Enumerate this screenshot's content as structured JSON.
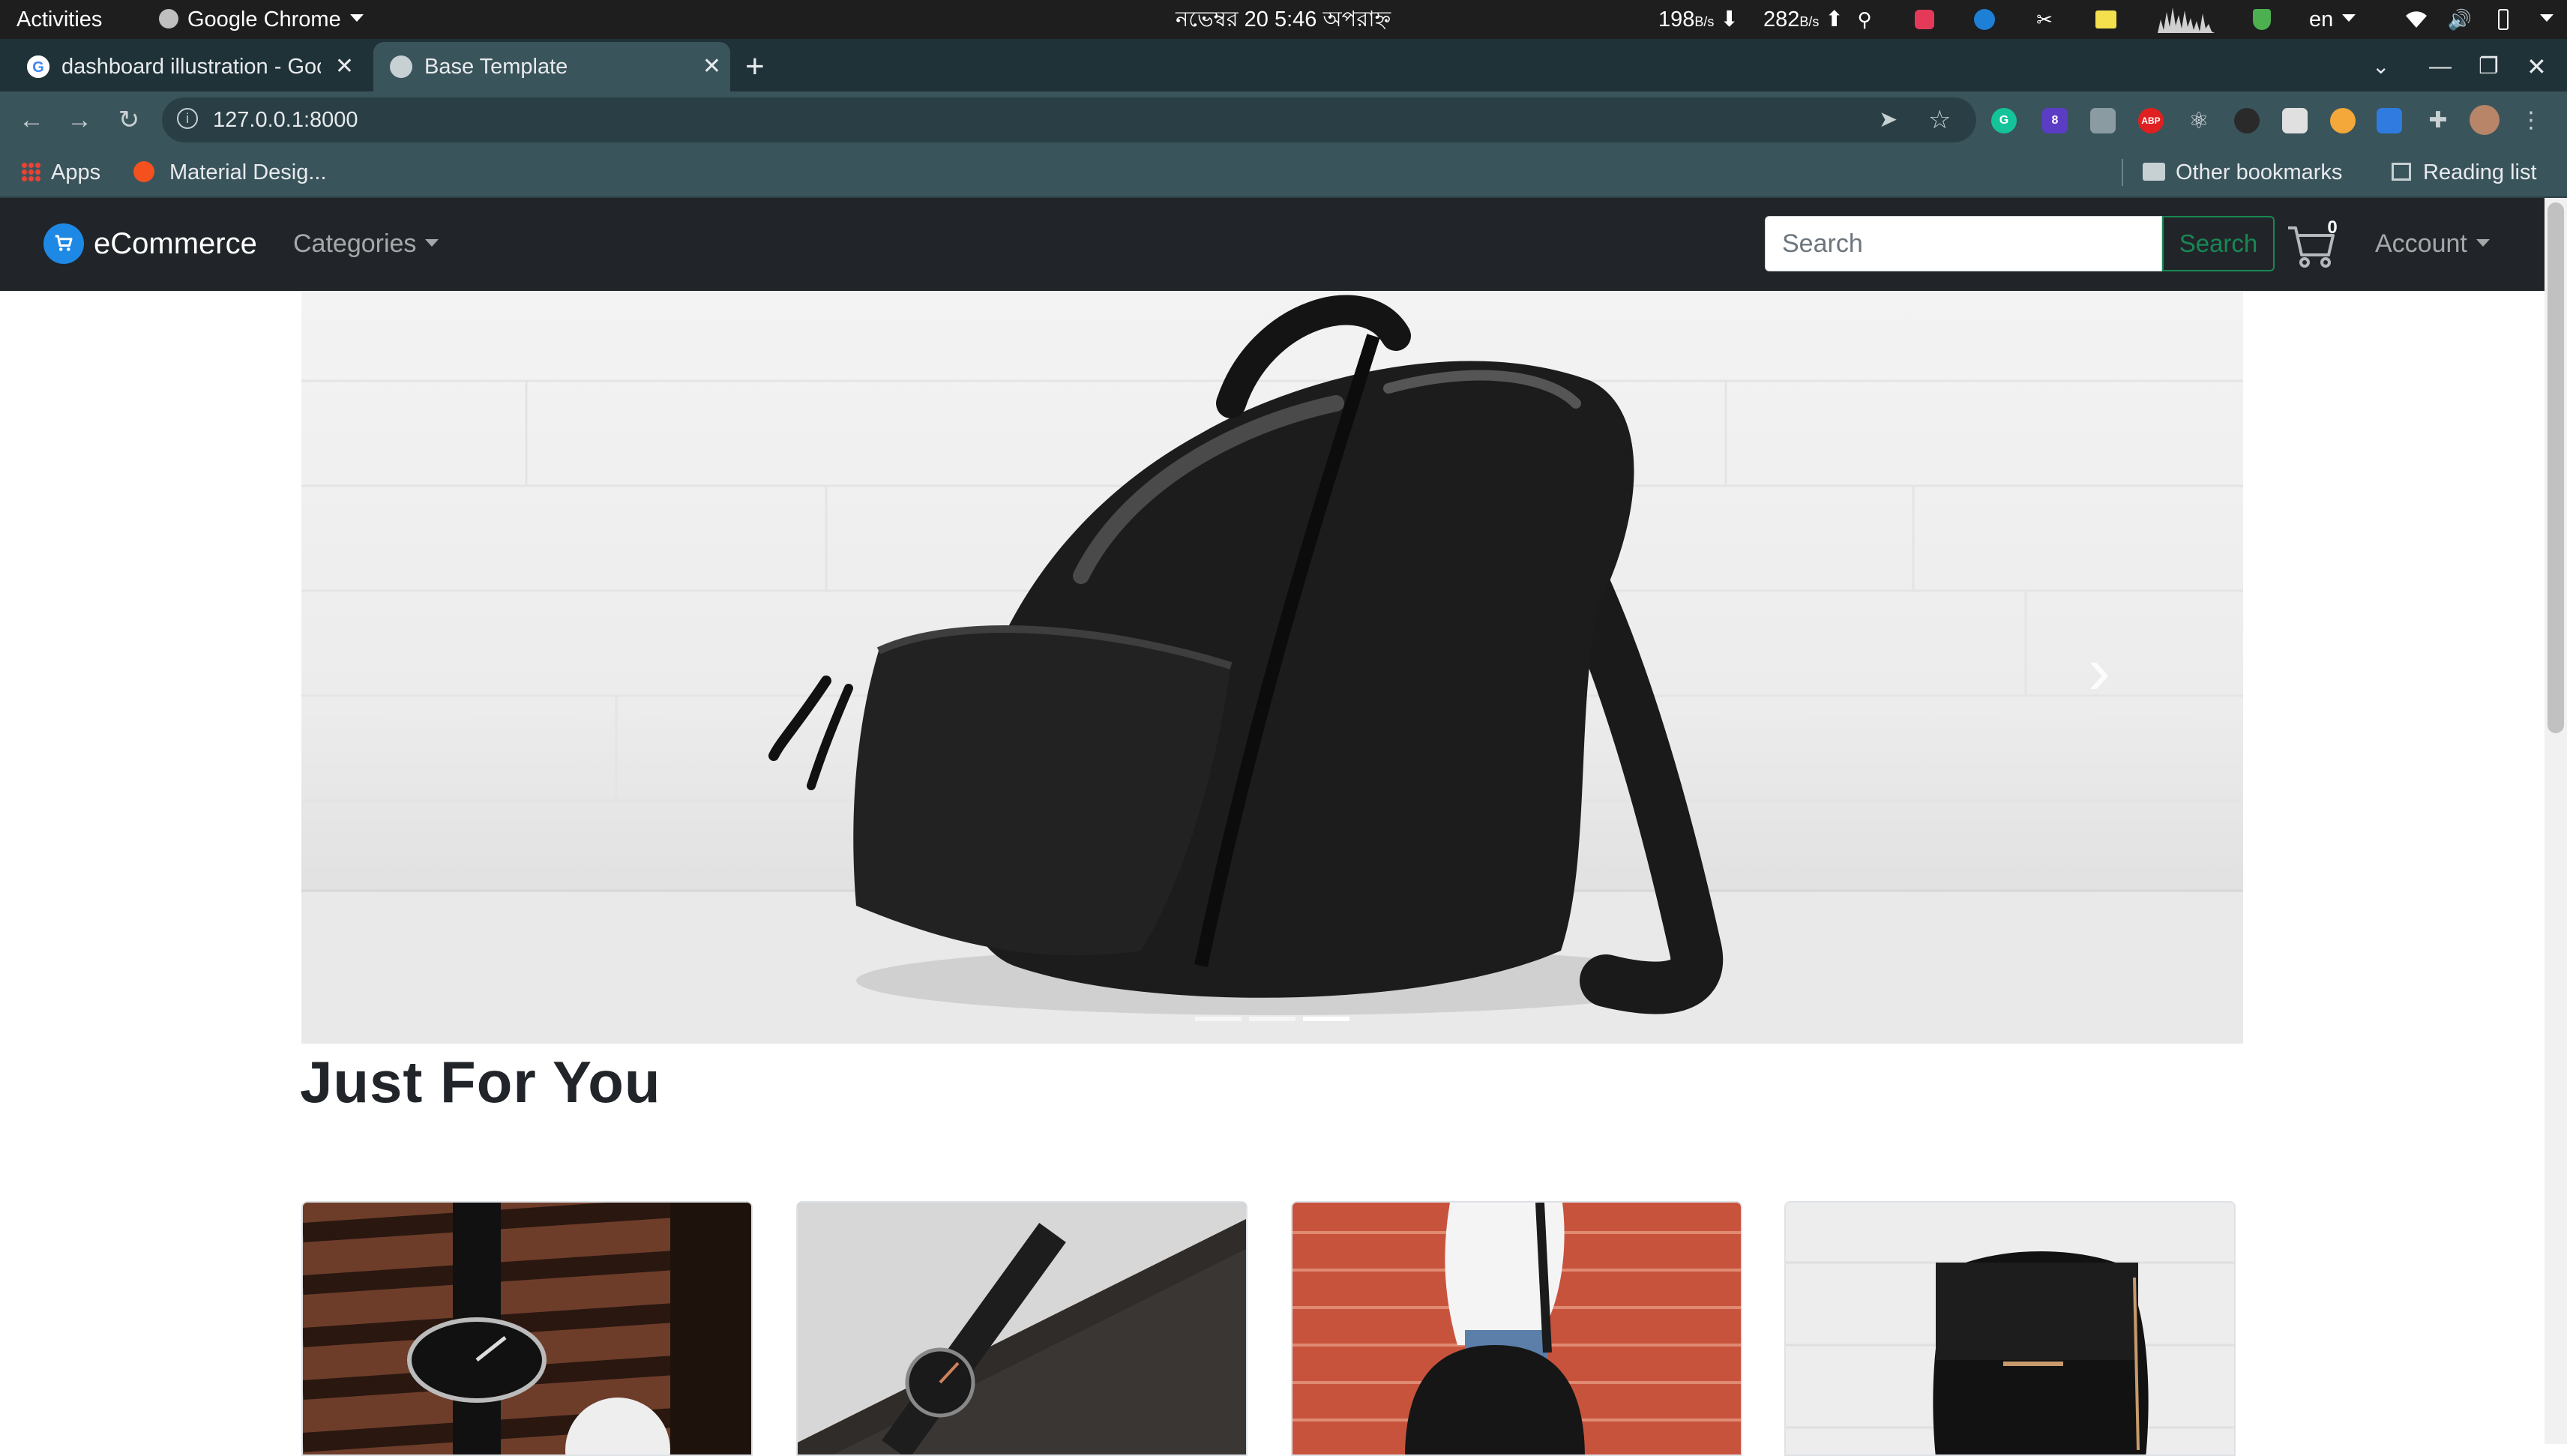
{
  "system_bar": {
    "activities": "Activities",
    "app_menu": "Google Chrome",
    "datetime": "নভেম্বর 20   5:46 অপরাহ্ন",
    "net_down": "198",
    "net_down_unit": "B/s",
    "net_up": "282",
    "net_up_unit": "B/s",
    "language": "en"
  },
  "browser": {
    "tabs": [
      {
        "title": "dashboard illustration - Google Search",
        "active": false
      },
      {
        "title": "Base Template",
        "active": true
      }
    ],
    "url": "127.0.0.1:8000",
    "bookmarks": [
      {
        "label": "Apps"
      },
      {
        "label": "Material Desig..."
      }
    ],
    "other_bookmarks": "Other bookmarks",
    "reading_list": "Reading list",
    "extensions": [
      "G",
      "8",
      "ABP"
    ]
  },
  "navbar": {
    "brand": "eCommerce",
    "categories": "Categories",
    "search_placeholder": "Search",
    "search_button": "Search",
    "cart_count": "0",
    "account": "Account"
  },
  "carousel": {
    "slide_count": 3,
    "active_slide": 3
  },
  "section": {
    "title": "Just For You"
  },
  "products": [
    {
      "image": "wristwatch-on-wood"
    },
    {
      "image": "wristwatch-on-marble"
    },
    {
      "image": "woman-with-handbag"
    },
    {
      "image": "black-backpack"
    }
  ],
  "colors": {
    "navbar_bg": "#212529",
    "brand_icon": "#1e88e5",
    "search_button": "#198754",
    "chrome_frame": "#3a545b"
  }
}
